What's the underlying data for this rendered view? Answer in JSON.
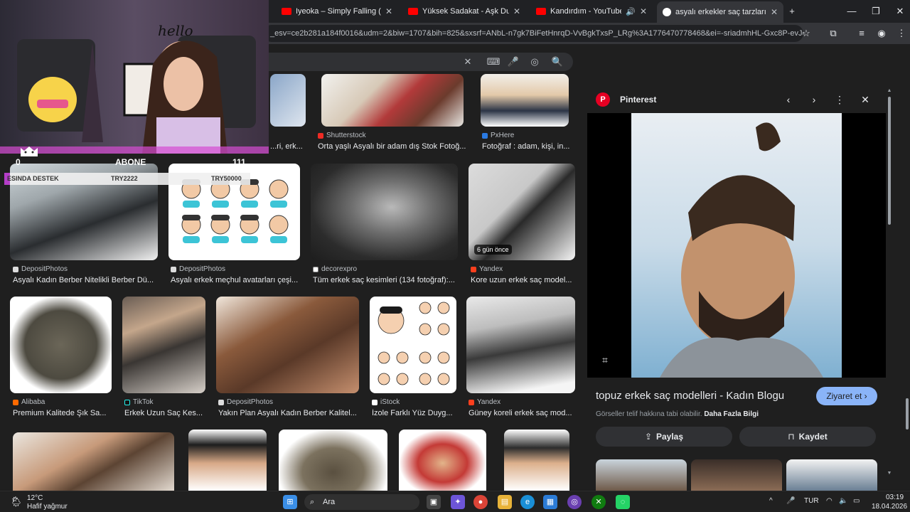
{
  "tabs": [
    {
      "title": "Iyeoka – Simply Falling (Official",
      "icon": "youtube-icon"
    },
    {
      "title": "Yüksek Sadakat - Aşk Durdukça",
      "icon": "youtube-icon"
    },
    {
      "title": "Kandırdım - YouTube",
      "icon": "youtube-icon"
    },
    {
      "title": "asyalı erkekler saç tarzları - Goo",
      "icon": "google-icon"
    }
  ],
  "url": "_esv=ce2b281a184f0016&udm=2&biw=1707&bih=825&sxsrf=ANbL-n7gk7BiFetHnrqD-VvBgkTxsP_LRg%3A1776470778468&ei=-sriadmhHL-Gxc8P-evJqQQ...",
  "account_initial": "E",
  "results": [
    {
      "source": "Shutterstock",
      "caption": "Orta yaşlı Asyalı bir adam dış Stok Fotoğ..."
    },
    {
      "source": "PxHere",
      "caption": "Fotoğraf : adam, kişi, in..."
    },
    {
      "source": "",
      "caption": "...ri, erk..."
    },
    {
      "source": "DepositPhotos",
      "caption": "Asyalı Kadın Berber Nitelikli Berber Dü..."
    },
    {
      "source": "DepositPhotos",
      "caption": "Asyalı erkek meçhul avatarları çeşi..."
    },
    {
      "source": "decorexpro",
      "caption": "Tüm erkek saç kesimleri (134 fotoğraf):..."
    },
    {
      "source": "Yandex",
      "caption": "Kore uzun erkek saç model...",
      "badge": "6 gün önce"
    },
    {
      "source": "Alibaba",
      "caption": "Premium Kalitede Şık Sa..."
    },
    {
      "source": "TikTok",
      "caption": "Erkek Uzun Saç Kes..."
    },
    {
      "source": "DepositPhotos",
      "caption": "Yakın Plan Asyalı Kadın Berber Kalitel..."
    },
    {
      "source": "iStock",
      "caption": "İzole Farklı Yüz Duyg..."
    },
    {
      "source": "Yandex",
      "caption": "Güney koreli erkek saç mod..."
    }
  ],
  "panel": {
    "source": "Pinterest",
    "title": "topuz erkek saç modelleri - Kadın Blogu",
    "visit_label": "Ziyaret et",
    "note": "Görseller telif hakkına tabi olabilir.",
    "note_link": "Daha Fazla Bilgi",
    "share_label": "Paylaş",
    "save_label": "Kaydet"
  },
  "overlay": {
    "handwriting": "hello",
    "count_left": "0",
    "abone_label": "ABONE",
    "count_right": "111",
    "donate_label": "ESINDA DESTEK",
    "donate_current": "TRY2222",
    "donate_goal": "TRY50000"
  },
  "taskbar": {
    "temperature": "12°C",
    "weather": "Hafif yağmur",
    "search_label": "Ara",
    "lang": "TUR",
    "time": "03:19",
    "date": "18.04.2026"
  },
  "colors": {
    "accent": "#8ab4f8",
    "pinterest": "#e60023",
    "youtube": "#ff0000"
  }
}
